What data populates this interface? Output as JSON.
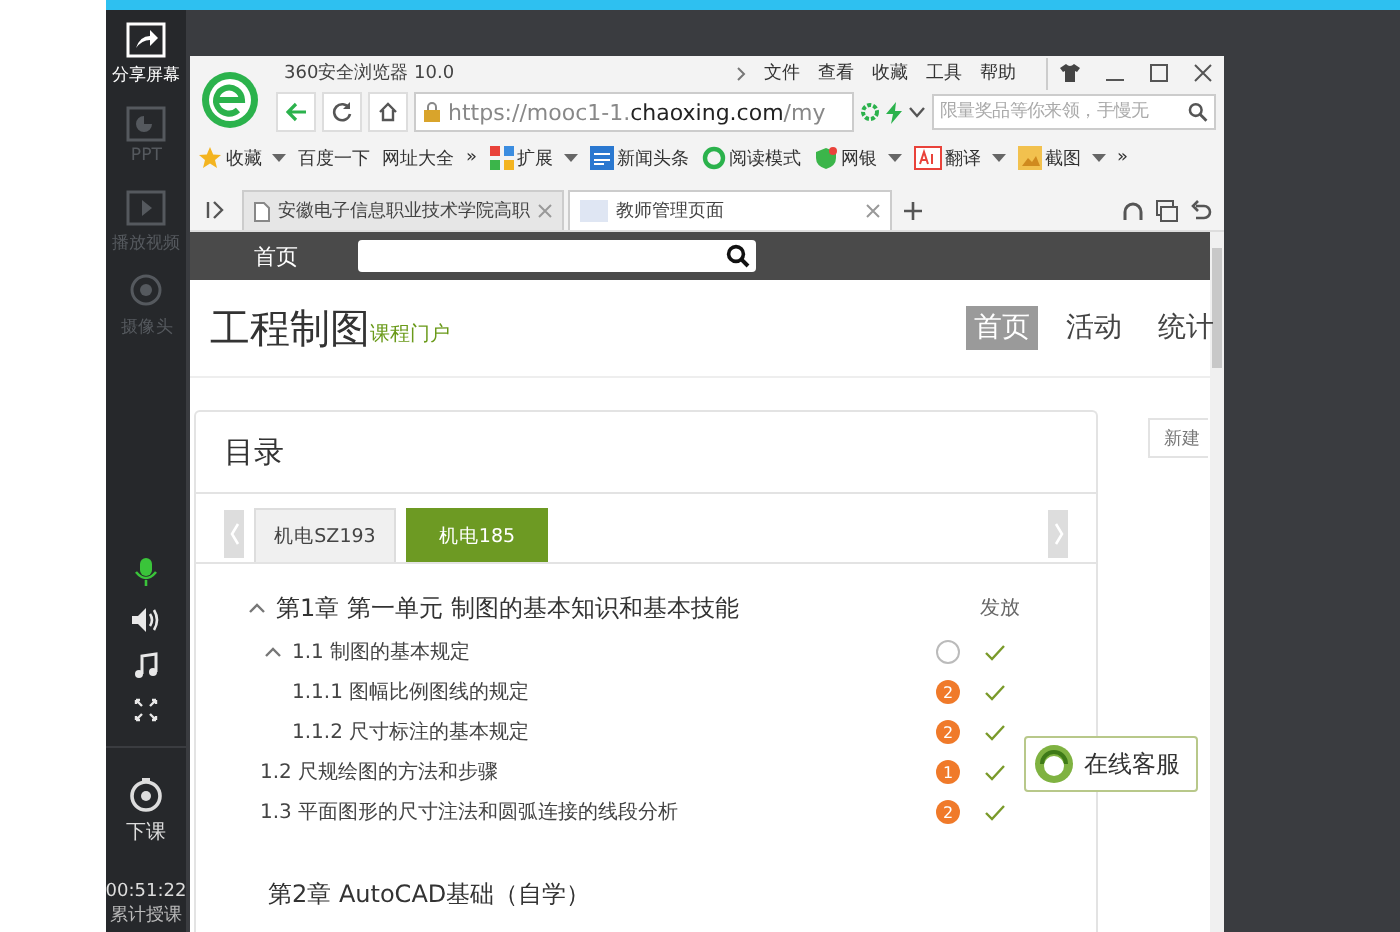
{
  "sidebar": {
    "items": [
      {
        "label": "分享屏幕",
        "kind": "share",
        "disabled": false
      },
      {
        "label": "PPT",
        "kind": "ppt",
        "disabled": true
      },
      {
        "label": "播放视频",
        "kind": "video",
        "disabled": true
      },
      {
        "label": "摄像头",
        "kind": "camera",
        "disabled": true
      }
    ],
    "controls": [
      {
        "kind": "mic",
        "on": true
      },
      {
        "kind": "speaker",
        "on": false
      },
      {
        "kind": "music",
        "on": false
      },
      {
        "kind": "expand",
        "on": false
      }
    ],
    "end_button": "下课",
    "timer": "00:51:22",
    "timer_label": "累计授课"
  },
  "browser": {
    "title": "360安全浏览器 10.0",
    "menu": [
      "文件",
      "查看",
      "收藏",
      "工具",
      "帮助"
    ],
    "url": {
      "host_prefix": "https://mooc1-1.",
      "host": "chaoxing.com",
      "path": "/my"
    },
    "search": {
      "placeholder": "限量奖品等你来领，手慢无"
    },
    "bookmarks": [
      {
        "label": "收藏",
        "kind": "star",
        "dropdown": true
      },
      {
        "label": "百度一下",
        "kind": "plain",
        "dropdown": false
      },
      {
        "label": "网址大全",
        "kind": "plain",
        "dropdown": false
      },
      {
        "label": "»",
        "kind": "more",
        "dropdown": false
      },
      {
        "label": "扩展",
        "kind": "apps",
        "dropdown": true
      },
      {
        "label": "新闻头条",
        "kind": "news",
        "dropdown": false
      },
      {
        "label": "阅读模式",
        "kind": "reader",
        "dropdown": false
      },
      {
        "label": "网银",
        "kind": "bank",
        "dropdown": true
      },
      {
        "label": "翻译",
        "kind": "translate",
        "dropdown": true
      },
      {
        "label": "截图",
        "kind": "scissors",
        "dropdown": true
      },
      {
        "label": "»",
        "kind": "more",
        "dropdown": false
      }
    ],
    "tabs": [
      {
        "label": "安徽电子信息职业技术学院高职",
        "selected": false
      },
      {
        "label": "教师管理页面",
        "selected": true
      }
    ]
  },
  "page": {
    "nav_label": "首页",
    "course": {
      "title": "工程制图",
      "subtitle": "课程门户"
    },
    "nav": [
      {
        "label": "首页",
        "selected": true
      },
      {
        "label": "活动",
        "selected": false
      },
      {
        "label": "统计",
        "selected": false
      }
    ],
    "side_button": "新建",
    "catalog": {
      "title": "目录",
      "classes": [
        {
          "label": "机电SZ193",
          "selected": false
        },
        {
          "label": "机电185",
          "selected": true
        }
      ],
      "chapters": [
        {
          "label": "第1章 第一单元 制图的基本知识和基本技能",
          "expanded": true,
          "column_label": "发放",
          "children": [
            {
              "label": "1.1 制图的基本规定",
              "expanded": true,
              "status": {
                "kind": "empty"
              },
              "released": true,
              "children": [
                {
                  "label": "1.1.1 图幅比例图线的规定",
                  "status": {
                    "kind": "count",
                    "text": "2"
                  },
                  "released": true
                },
                {
                  "label": "1.1.2 尺寸标注的基本规定",
                  "status": {
                    "kind": "count",
                    "text": "2"
                  },
                  "released": true
                }
              ]
            },
            {
              "label": "1.2 尺规绘图的方法和步骤",
              "status": {
                "kind": "count",
                "text": "1"
              },
              "released": true
            },
            {
              "label": "1.3 平面图形的尺寸注法和圆弧连接的线段分析",
              "status": {
                "kind": "count",
                "text": "2"
              },
              "released": true
            }
          ]
        },
        {
          "label": "第2章 AutoCAD基础（自学）"
        }
      ]
    },
    "service_button": "在线客服"
  }
}
